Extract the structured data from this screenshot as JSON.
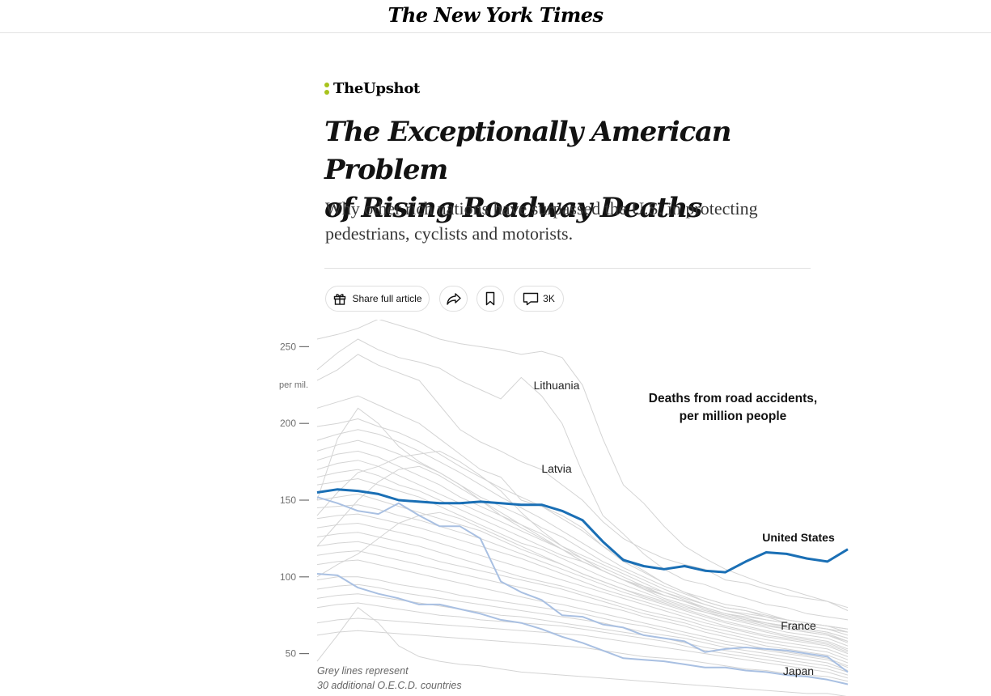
{
  "masthead": {
    "logo": "The New York Times"
  },
  "section": {
    "name": "TheUpshot"
  },
  "article": {
    "headline_line1": "The Exceptionally American Problem",
    "headline_line2": "of Rising Roadway Deaths",
    "summary_line1": "Why other rich nations have surpassed the U.S. in protecting",
    "summary_line2": "pedestrians, cyclists and motorists."
  },
  "actions": {
    "share_label": "Share full article",
    "comments_count": "3K"
  },
  "icons": [
    "gift-icon",
    "share-arrow-icon",
    "bookmark-icon",
    "comment-icon"
  ],
  "colors": {
    "us_line": "#1a6fb5",
    "highlight_line": "#a9c0e2",
    "grey_line": "#d4d4d4",
    "upshot_accent": "#a8c31c"
  },
  "chart_data": {
    "type": "line",
    "title": "Deaths from road accidents,",
    "title_line2": "per million people",
    "ylim": [
      25,
      265
    ],
    "yticks": [
      50,
      100,
      150,
      200,
      250
    ],
    "ytick_labels": [
      "50",
      "100",
      "150",
      "200",
      "250"
    ],
    "yunit": "per mil.",
    "grid": false,
    "note_line1": "Grey lines represent",
    "note_line2": "30 additional O.E.C.D. countries",
    "highlight_series": [
      {
        "name": "United States",
        "color": "#1a6fb5",
        "values": [
          155,
          157,
          156,
          154,
          150,
          149,
          148,
          148,
          149,
          148,
          147,
          147,
          143,
          137,
          123,
          111,
          107,
          105,
          107,
          104,
          103,
          110,
          116,
          115,
          112,
          110,
          118
        ]
      },
      {
        "name": "France",
        "color": "#a9c0e2",
        "values": [
          152,
          148,
          143,
          141,
          148,
          140,
          133,
          133,
          125,
          97,
          90,
          85,
          75,
          74,
          69,
          67,
          62,
          60,
          58,
          51,
          53,
          54,
          53,
          52,
          50,
          48,
          38
        ]
      },
      {
        "name": "Japan",
        "color": "#a9c0e2",
        "values": [
          102,
          101,
          93,
          89,
          86,
          82,
          82,
          79,
          76,
          72,
          70,
          66,
          61,
          57,
          52,
          47,
          46,
          45,
          43,
          41,
          41,
          39,
          38,
          36,
          35,
          33,
          30
        ]
      }
    ],
    "series_labels": [
      {
        "name": "Lithuania"
      },
      {
        "name": "Latvia"
      }
    ],
    "grey_series": [
      [
        255,
        258,
        262,
        268,
        264,
        260,
        255,
        252,
        250,
        248,
        245,
        247,
        243,
        225,
        190,
        160,
        148,
        133,
        120,
        112,
        105,
        100,
        95,
        92,
        88,
        84,
        78
      ],
      [
        235,
        246,
        255,
        248,
        243,
        240,
        236,
        228,
        222,
        216,
        230,
        218,
        200,
        168,
        140,
        128,
        115,
        105,
        98,
        95,
        90,
        86,
        82,
        80,
        76,
        74,
        72
      ],
      [
        228,
        235,
        245,
        238,
        233,
        228,
        212,
        196,
        188,
        182,
        175,
        170,
        160,
        150,
        136,
        125,
        118,
        112,
        108,
        105,
        98,
        96,
        92,
        88,
        86,
        84,
        80
      ],
      [
        210,
        214,
        218,
        212,
        206,
        200,
        190,
        180,
        170,
        165,
        150,
        146,
        140,
        132,
        120,
        112,
        104,
        96,
        90,
        84,
        80,
        78,
        74,
        70,
        68,
        66,
        64
      ],
      [
        198,
        200,
        203,
        198,
        194,
        188,
        180,
        172,
        165,
        158,
        152,
        146,
        138,
        130,
        120,
        110,
        103,
        96,
        90,
        86,
        82,
        80,
        76,
        72,
        70,
        68,
        66
      ],
      [
        189,
        193,
        196,
        193,
        188,
        182,
        175,
        168,
        160,
        152,
        145,
        138,
        130,
        122,
        114,
        106,
        100,
        94,
        89,
        84,
        80,
        78,
        75,
        72,
        70,
        68,
        64
      ],
      [
        182,
        186,
        189,
        185,
        180,
        174,
        168,
        160,
        152,
        146,
        140,
        132,
        126,
        118,
        110,
        104,
        98,
        92,
        87,
        82,
        78,
        75,
        72,
        70,
        68,
        66,
        62
      ],
      [
        176,
        180,
        182,
        178,
        172,
        166,
        160,
        152,
        146,
        140,
        134,
        128,
        120,
        114,
        108,
        102,
        96,
        90,
        85,
        80,
        76,
        73,
        70,
        68,
        66,
        64,
        60
      ],
      [
        170,
        174,
        176,
        172,
        166,
        160,
        154,
        148,
        142,
        136,
        130,
        124,
        118,
        112,
        106,
        100,
        94,
        88,
        84,
        80,
        76,
        73,
        70,
        67,
        65,
        63,
        58
      ],
      [
        165,
        168,
        170,
        166,
        160,
        156,
        150,
        144,
        138,
        132,
        126,
        120,
        114,
        110,
        104,
        98,
        93,
        88,
        84,
        79,
        75,
        72,
        69,
        66,
        64,
        62,
        57
      ],
      [
        160,
        162,
        164,
        160,
        156,
        152,
        146,
        140,
        134,
        128,
        122,
        118,
        112,
        106,
        100,
        95,
        90,
        85,
        81,
        77,
        73,
        70,
        67,
        64,
        62,
        60,
        55
      ],
      [
        150,
        152,
        154,
        150,
        146,
        142,
        138,
        134,
        130,
        124,
        118,
        113,
        108,
        102,
        97,
        92,
        87,
        83,
        79,
        75,
        71,
        68,
        65,
        62,
        60,
        58,
        53
      ],
      [
        145,
        146,
        147,
        144,
        140,
        137,
        133,
        129,
        125,
        120,
        115,
        110,
        105,
        100,
        95,
        90,
        86,
        82,
        78,
        74,
        70,
        67,
        64,
        61,
        59,
        57,
        52
      ],
      [
        138,
        140,
        141,
        138,
        135,
        132,
        128,
        124,
        120,
        116,
        112,
        107,
        102,
        97,
        92,
        88,
        84,
        80,
        76,
        72,
        68,
        65,
        62,
        60,
        58,
        56,
        51
      ],
      [
        132,
        134,
        135,
        132,
        129,
        126,
        122,
        118,
        114,
        110,
        106,
        102,
        98,
        94,
        90,
        86,
        82,
        78,
        74,
        70,
        67,
        64,
        61,
        59,
        57,
        55,
        50
      ],
      [
        126,
        128,
        129,
        126,
        123,
        120,
        116,
        112,
        108,
        104,
        100,
        97,
        94,
        90,
        86,
        82,
        78,
        75,
        72,
        68,
        65,
        62,
        59,
        57,
        55,
        53,
        48
      ],
      [
        120,
        122,
        123,
        120,
        117,
        114,
        110,
        107,
        104,
        101,
        98,
        95,
        92,
        88,
        84,
        80,
        76,
        73,
        70,
        66,
        63,
        60,
        57,
        55,
        53,
        51,
        46
      ],
      [
        114,
        116,
        117,
        114,
        111,
        108,
        105,
        102,
        99,
        96,
        93,
        90,
        87,
        84,
        81,
        78,
        74,
        71,
        68,
        64,
        61,
        58,
        55,
        53,
        51,
        49,
        44
      ],
      [
        108,
        110,
        111,
        108,
        105,
        102,
        99,
        96,
        93,
        90,
        87,
        84,
        82,
        79,
        76,
        73,
        70,
        67,
        64,
        61,
        58,
        56,
        53,
        51,
        49,
        47,
        42
      ],
      [
        98,
        100,
        100,
        98,
        95,
        93,
        91,
        88,
        86,
        84,
        82,
        80,
        78,
        76,
        73,
        70,
        68,
        65,
        62,
        59,
        56,
        54,
        52,
        50,
        48,
        46,
        41
      ],
      [
        92,
        94,
        95,
        93,
        90,
        88,
        86,
        84,
        82,
        80,
        78,
        76,
        74,
        72,
        70,
        67,
        64,
        62,
        60,
        57,
        54,
        52,
        50,
        48,
        46,
        44,
        39
      ],
      [
        86,
        88,
        89,
        87,
        85,
        83,
        81,
        79,
        77,
        75,
        74,
        72,
        70,
        68,
        66,
        64,
        62,
        60,
        57,
        54,
        52,
        50,
        48,
        46,
        44,
        42,
        38
      ],
      [
        80,
        82,
        83,
        81,
        79,
        77,
        75,
        74,
        72,
        71,
        70,
        69,
        68,
        66,
        64,
        62,
        60,
        58,
        55,
        52,
        50,
        48,
        46,
        44,
        42,
        40,
        36
      ],
      [
        70,
        72,
        73,
        72,
        71,
        70,
        69,
        68,
        67,
        66,
        65,
        64,
        63,
        62,
        60,
        58,
        56,
        54,
        52,
        50,
        48,
        46,
        44,
        42,
        40,
        38,
        34
      ],
      [
        62,
        64,
        65,
        64,
        63,
        62,
        61,
        60,
        59,
        58,
        57,
        56,
        55,
        54,
        52,
        50,
        48,
        47,
        46,
        44,
        42,
        40,
        39,
        37,
        36,
        35,
        32
      ],
      [
        45,
        62,
        80,
        70,
        55,
        48,
        45,
        43,
        42,
        40,
        38,
        37,
        36,
        35,
        34,
        33,
        32,
        31,
        30,
        29,
        28,
        27,
        26,
        25,
        24,
        24,
        22
      ],
      [
        140,
        155,
        168,
        172,
        178,
        180,
        182,
        175,
        166,
        156,
        142,
        130,
        120,
        112,
        104,
        98,
        92,
        86,
        82,
        78,
        75,
        72,
        70,
        68,
        66,
        64,
        60
      ],
      [
        150,
        190,
        210,
        200,
        185,
        175,
        168,
        160,
        150,
        140,
        132,
        125,
        118,
        110,
        104,
        98,
        94,
        90,
        86,
        82,
        78,
        76,
        74,
        72,
        70,
        68,
        66
      ],
      [
        120,
        135,
        150,
        162,
        170,
        172,
        166,
        158,
        150,
        142,
        134,
        126,
        118,
        110,
        104,
        98,
        92,
        88,
        84,
        80,
        76,
        74,
        72,
        70,
        68,
        66,
        64
      ],
      [
        100,
        108,
        115,
        125,
        135,
        140,
        142,
        138,
        132,
        126,
        120,
        114,
        108,
        102,
        97,
        92,
        88,
        84,
        80,
        77,
        74,
        71,
        68,
        66,
        64,
        62,
        58
      ]
    ]
  }
}
